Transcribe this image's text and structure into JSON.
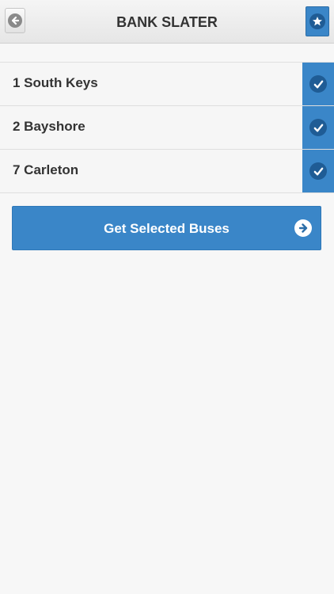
{
  "header": {
    "title": "BANK SLATER",
    "back_icon": "arrow-left-circle-icon",
    "favorite_icon": "star-icon"
  },
  "routes": [
    {
      "label": "1 South Keys",
      "selected": true
    },
    {
      "label": "2 Bayshore",
      "selected": true
    },
    {
      "label": "7 Carleton",
      "selected": true
    }
  ],
  "actions": {
    "get_buses_label": "Get Selected Buses",
    "get_buses_icon": "arrow-right-circle-icon"
  },
  "colors": {
    "accent": "#3a86c8",
    "accent_dark": "#1f5c95",
    "background": "#f7f7f7",
    "text": "#333333"
  }
}
